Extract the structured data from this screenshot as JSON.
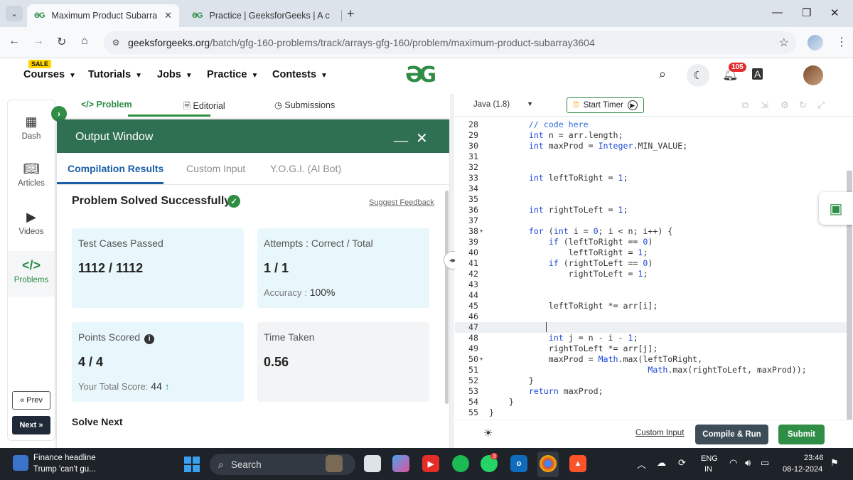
{
  "browser": {
    "tabs": [
      {
        "title": "Maximum Product Subarray | P",
        "active": true
      },
      {
        "title": "Practice | GeeksforGeeks | A co",
        "active": false
      }
    ],
    "url_domain": "geeksforgeeks.org",
    "url_path": "/batch/gfg-160-problems/track/arrays-gfg-160/problem/maximum-product-subarray3604"
  },
  "header": {
    "sale_badge": "SALE",
    "nav": [
      "Courses",
      "Tutorials",
      "Jobs",
      "Practice",
      "Contests"
    ],
    "logo": "ƏG",
    "notification_count": "105"
  },
  "sidebar": {
    "items": [
      "Dash",
      "Articles",
      "Videos",
      "Problems"
    ],
    "prev": "« Prev",
    "next": "Next »"
  },
  "problem_tabs": [
    "</> Problem",
    "Editorial",
    "Submissions"
  ],
  "output_window": {
    "title": "Output Window",
    "tabs": [
      "Compilation Results",
      "Custom Input",
      "Y.O.G.I. (AI Bot)"
    ],
    "status": "Problem Solved Successfully",
    "suggest_feedback": "Suggest Feedback",
    "test_cases_label": "Test Cases Passed",
    "test_cases_value": "1112 / 1112",
    "attempts_label": "Attempts : Correct / Total",
    "attempts_value": "1 / 1",
    "accuracy_label": "Accuracy :",
    "accuracy_value": "100%",
    "points_label": "Points Scored",
    "points_value": "4 / 4",
    "total_score_label": "Your Total Score:",
    "total_score_value": "44",
    "time_label": "Time Taken",
    "time_value": "0.56",
    "solve_next": "Solve Next"
  },
  "editor": {
    "language": "Java (1.8)",
    "timer": "Start Timer",
    "custom_input": "Custom Input",
    "compile_run": "Compile & Run",
    "submit": "Submit",
    "code_lines": [
      {
        "n": "28",
        "t": "        // code here"
      },
      {
        "n": "29",
        "t": "        int n = arr.length;"
      },
      {
        "n": "30",
        "t": "        int maxProd = Integer.MIN_VALUE;"
      },
      {
        "n": "31",
        "t": ""
      },
      {
        "n": "32",
        "t": ""
      },
      {
        "n": "33",
        "t": "        int leftToRight = 1;"
      },
      {
        "n": "34",
        "t": ""
      },
      {
        "n": "35",
        "t": ""
      },
      {
        "n": "36",
        "t": "        int rightToLeft = 1;"
      },
      {
        "n": "37",
        "t": ""
      },
      {
        "n": "38",
        "t": "        for (int i = 0; i < n; i++) {"
      },
      {
        "n": "39",
        "t": "            if (leftToRight == 0)"
      },
      {
        "n": "40",
        "t": "                leftToRight = 1;"
      },
      {
        "n": "41",
        "t": "            if (rightToLeft == 0)"
      },
      {
        "n": "42",
        "t": "                rightToLeft = 1;"
      },
      {
        "n": "43",
        "t": ""
      },
      {
        "n": "44",
        "t": ""
      },
      {
        "n": "45",
        "t": "            leftToRight *= arr[i];"
      },
      {
        "n": "46",
        "t": ""
      },
      {
        "n": "47",
        "t": ""
      },
      {
        "n": "48",
        "t": "            int j = n - i - 1;"
      },
      {
        "n": "49",
        "t": "            rightToLeft *= arr[j];"
      },
      {
        "n": "50",
        "t": "            maxProd = Math.max(leftToRight,"
      },
      {
        "n": "51",
        "t": "                                Math.max(rightToLeft, maxProd));"
      },
      {
        "n": "52",
        "t": "        }"
      },
      {
        "n": "53",
        "t": "        return maxProd;"
      },
      {
        "n": "54",
        "t": "    }"
      },
      {
        "n": "55",
        "t": "}"
      }
    ]
  },
  "taskbar": {
    "news_title": "Finance headline",
    "news_text": "Trump 'can't gu...",
    "search": "Search",
    "whatsapp_badge": "3",
    "lang": "ENG",
    "region": "IN",
    "time": "23:46",
    "date": "08-12-2024"
  }
}
